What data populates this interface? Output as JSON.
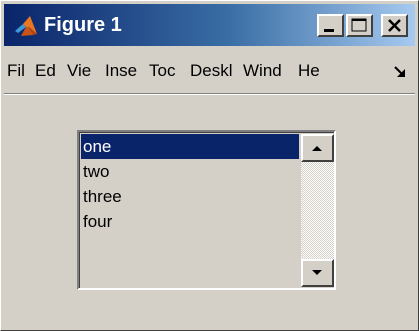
{
  "window": {
    "title": "Figure 1",
    "icon": "matlab-logo-icon",
    "controls": [
      "minimize-icon",
      "maximize-icon",
      "close-icon"
    ]
  },
  "menubar": {
    "items": [
      "Fil",
      "Ed",
      "Vie",
      "Inse",
      "Toc",
      "Deskl",
      "Wind",
      "He"
    ],
    "dock_icon": "dock-arrow-icon"
  },
  "listbox": {
    "items": [
      "one",
      "two",
      "three",
      "four"
    ],
    "selected_index": 0,
    "selection_color": "#0a246a"
  },
  "colors": {
    "title_gradient_start": "#0a246a",
    "title_gradient_end": "#a6caf0",
    "face": "#d4d0c8"
  }
}
